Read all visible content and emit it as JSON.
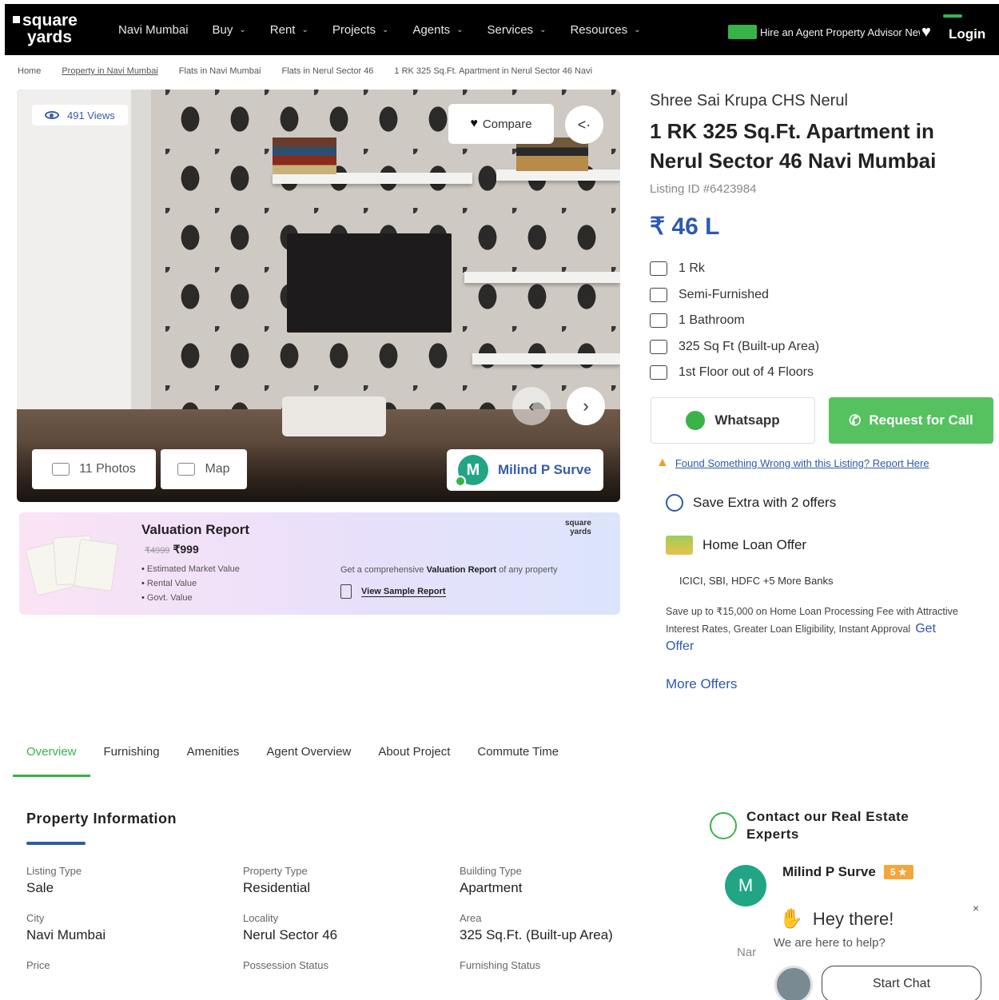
{
  "nav": {
    "logo_line1": "square",
    "logo_line2": "yards",
    "items": [
      {
        "label": "Navi Mumbai",
        "dropdown": false
      },
      {
        "label": "Buy",
        "dropdown": true
      },
      {
        "label": "Rent",
        "dropdown": true
      },
      {
        "label": "Projects",
        "dropdown": true
      },
      {
        "label": "Agents",
        "dropdown": true
      },
      {
        "label": "Services",
        "dropdown": true
      },
      {
        "label": "Resources",
        "dropdown": true
      }
    ],
    "promo_text": "Hire an Agent Property Advisor New",
    "login": "Login"
  },
  "breadcrumb": [
    "Home",
    "Property in Navi Mumbai",
    "Flats in Navi Mumbai",
    "Flats in Nerul Sector 46",
    "1 RK 325 Sq.Ft. Apartment in Nerul Sector 46 Navi"
  ],
  "gallery": {
    "views": "491 Views",
    "compare": "Compare",
    "photos": "11 Photos",
    "map": "Map",
    "agent_initial": "M",
    "agent_name": "Milind P Surve"
  },
  "valuation": {
    "title": "Valuation Report",
    "old_price": "₹4999",
    "price": "₹999",
    "bullets": [
      "Estimated Market Value",
      "Rental Value",
      "Govt. Value"
    ],
    "cta_prefix": "Get a comprehensive",
    "cta_bold": "Valuation Report",
    "cta_suffix": "of any property",
    "link": "View Sample Report",
    "logo_line1": "square",
    "logo_line2": "yards"
  },
  "listing": {
    "project": "Shree Sai Krupa CHS Nerul",
    "title": "1 RK 325 Sq.Ft. Apartment in Nerul Sector 46 Navi Mumbai",
    "listing_id": "Listing ID #6423984",
    "price": "₹ 46 L",
    "specs": [
      {
        "icon": "bed-icon",
        "text": "1 Rk"
      },
      {
        "icon": "sofa-icon",
        "text": "Semi-Furnished"
      },
      {
        "icon": "bathtub-icon",
        "text": "1 Bathroom"
      },
      {
        "icon": "area-icon",
        "text": "325 Sq Ft  (Built-up Area)"
      },
      {
        "icon": "floor-icon",
        "text": "1st Floor out of 4 Floors"
      }
    ],
    "whatsapp": "Whatsapp",
    "call": "Request for Call",
    "report": "Found Something Wrong with this Listing? Report Here"
  },
  "offers": {
    "title": "Save Extra with 2 offers",
    "home_loan": "Home Loan Offer",
    "banks": "ICICI, SBI, HDFC +5 More Banks",
    "desc": "Save up to ₹15,000 on Home Loan Processing Fee with Attractive Interest Rates, Greater Loan Eligibility, Instant Approval",
    "get_offer": "Get Offer",
    "more": "More Offers"
  },
  "tabs": [
    {
      "label": "Overview",
      "active": true
    },
    {
      "label": "Furnishing",
      "active": false
    },
    {
      "label": "Amenities",
      "active": false
    },
    {
      "label": "Agent Overview",
      "active": false
    },
    {
      "label": "About Project",
      "active": false
    },
    {
      "label": "Commute Time",
      "active": false
    }
  ],
  "property_info": {
    "title": "Property Information",
    "rows": [
      {
        "label": "Listing Type",
        "value": "Sale"
      },
      {
        "label": "Property Type",
        "value": "Residential"
      },
      {
        "label": "Building Type",
        "value": "Apartment"
      },
      {
        "label": "City",
        "value": "Navi Mumbai"
      },
      {
        "label": "Locality",
        "value": "Nerul Sector 46"
      },
      {
        "label": "Area",
        "value": "325 Sq.Ft. (Built-up Area)"
      },
      {
        "label": "Price",
        "value": ""
      },
      {
        "label": "Possession Status",
        "value": ""
      },
      {
        "label": "Furnishing Status",
        "value": ""
      }
    ]
  },
  "contact": {
    "title": "Contact our Real Estate Experts",
    "agent_initial": "M",
    "agent_name": "Milind P Surve",
    "rating": "5 ★",
    "nar": "Nar",
    "greeting": "Hey there!",
    "help": "We are here to help?",
    "close": "×",
    "start_chat": "Start Chat"
  },
  "colors": {
    "brand_green": "#38b34a",
    "link_blue": "#2e5aa8",
    "nav_bg": "#000000"
  }
}
